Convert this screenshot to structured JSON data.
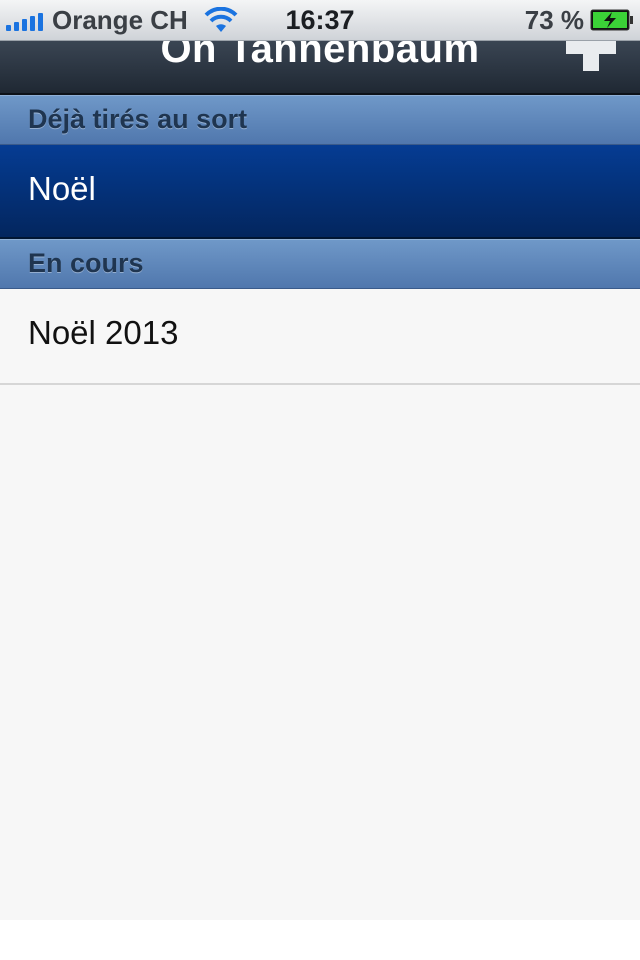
{
  "status_bar": {
    "carrier": "Orange CH",
    "time": "16:37",
    "battery_percent": "73 %",
    "signal_bars": 5,
    "wifi_icon": "wifi-icon",
    "battery_icon": "battery-charging-icon",
    "signal_color": "#1a73e0",
    "battery_color": "#3bd137"
  },
  "nav_bar": {
    "title": "Oh Tannenbaum",
    "add_icon": "plus-icon"
  },
  "sections": [
    {
      "header": "Déjà tirés au sort",
      "items": [
        {
          "label": "Noël",
          "selected": true
        }
      ]
    },
    {
      "header": "En cours",
      "items": [
        {
          "label": "Noël 2013",
          "selected": false
        }
      ]
    }
  ],
  "colors": {
    "section_header": "#5f88bd",
    "selected_row": "#053c93",
    "navbar": "#2b3441",
    "table_background": "#f7f7f7"
  }
}
